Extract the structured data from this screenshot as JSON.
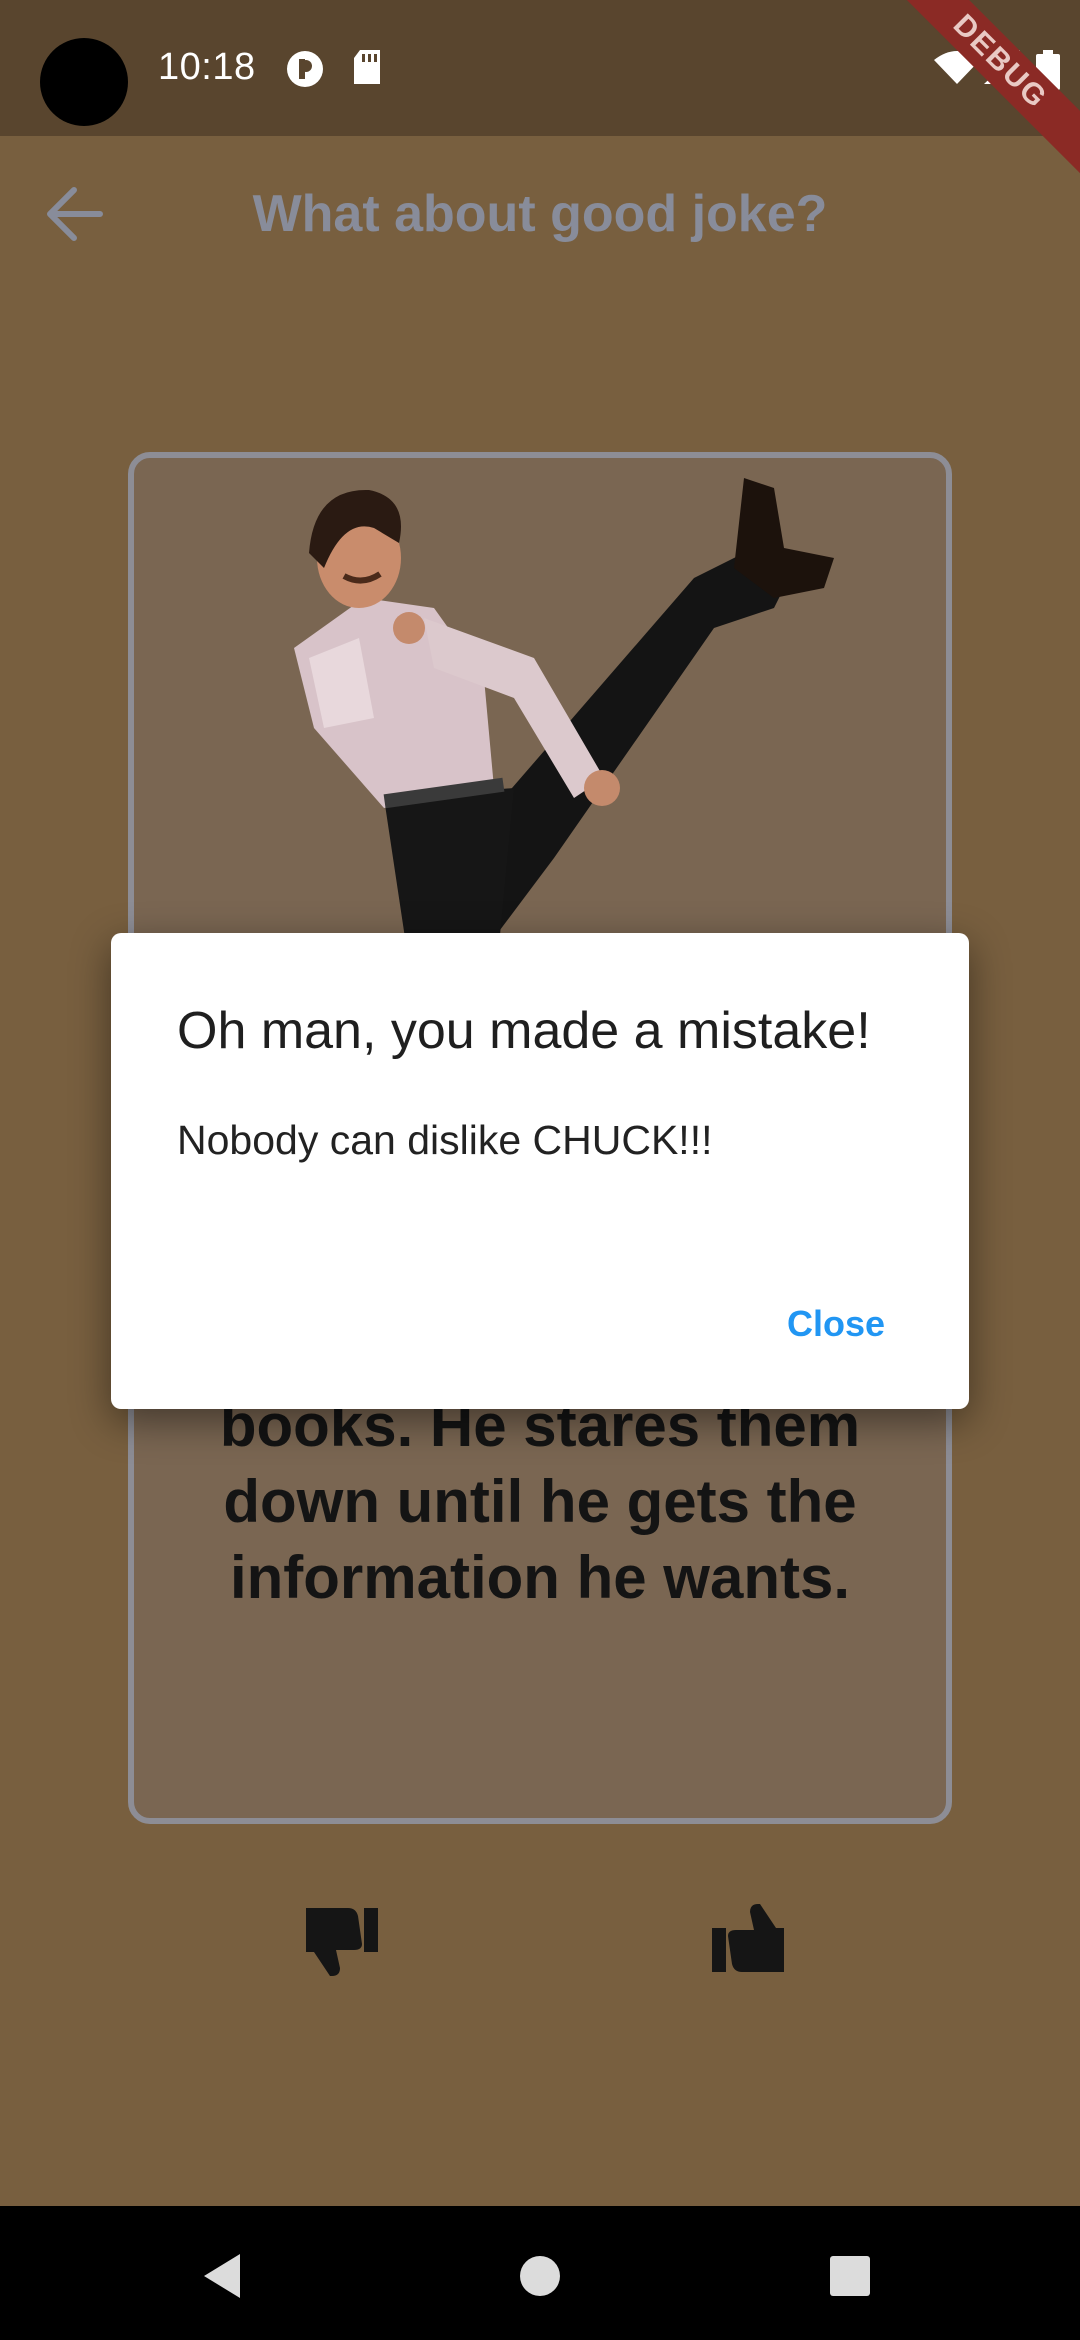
{
  "status_bar": {
    "time": "10:18",
    "debug_label": "DEBUG",
    "icons": [
      "camera-cutout",
      "vpn-key-icon",
      "sd-card-icon",
      "wifi-icon",
      "signal-icon",
      "battery-icon"
    ]
  },
  "app_bar": {
    "title": "What about good joke?",
    "back_icon": "arrow-back-icon"
  },
  "joke_card": {
    "image": "chuck-norris-kick-image",
    "text_lines": [
      "books. He stares them",
      "down until he gets the",
      "information he wants."
    ]
  },
  "actions": {
    "dislike_icon": "thumb-down-icon",
    "like_icon": "thumb-up-icon"
  },
  "dialog": {
    "title": "Oh man, you made a mistake!",
    "body": "Nobody can dislike CHUCK!!!",
    "close_label": "Close"
  },
  "nav_bar": {
    "icons": [
      "back-triangle-icon",
      "home-circle-icon",
      "recents-square-icon"
    ]
  },
  "colors": {
    "background": "#785f3f",
    "status_bar": "#59452e",
    "dialog_button": "#2196f3",
    "card_border": "#8d8d95"
  }
}
